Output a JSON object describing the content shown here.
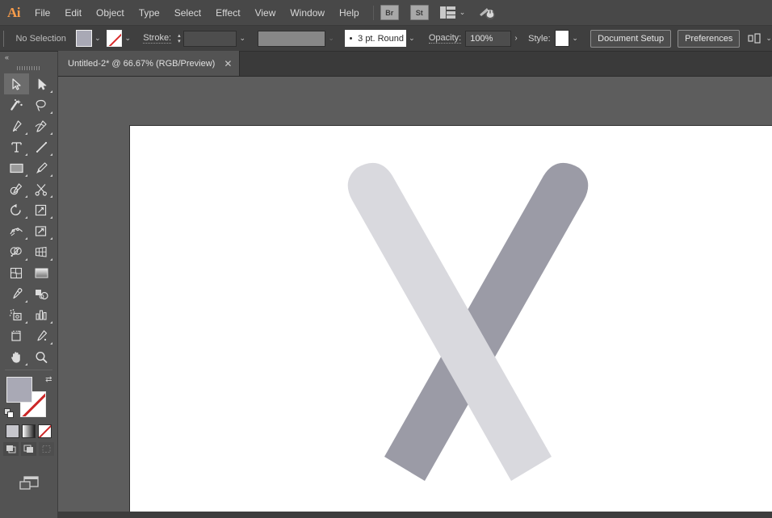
{
  "app": {
    "name": "Adobe Illustrator",
    "logo_text": "Ai"
  },
  "menubar": {
    "items": [
      {
        "label": "File"
      },
      {
        "label": "Edit"
      },
      {
        "label": "Object"
      },
      {
        "label": "Type"
      },
      {
        "label": "Select"
      },
      {
        "label": "Effect"
      },
      {
        "label": "View"
      },
      {
        "label": "Window"
      },
      {
        "label": "Help"
      }
    ],
    "bridge_label": "Br",
    "stock_label": "St",
    "arrange_icon": "arrange-documents-icon",
    "arrange_chevron": "⌄",
    "workspace_icon": "workspace-switcher-icon"
  },
  "controlbar": {
    "selection_status": "No Selection",
    "fill_swatch_label": "fill-color",
    "fill_color": "#a9a9b5",
    "fill_chevron": "⌄",
    "stroke_swatch_label": "stroke-none",
    "stroke_color": "none",
    "stroke_chevron": "⌄",
    "stroke_label": "Stroke:",
    "stroke_weight_value": "",
    "stepper_up": "▴",
    "stepper_down": "▾",
    "stroke_field_chevron": "⌄",
    "variable_width_chevron": "⌄",
    "brush_definition": "3 pt. Round",
    "brush_chevron": "⌄",
    "opacity_label": "Opacity:",
    "opacity_value": "100%",
    "opacity_more": "›",
    "style_label": "Style:",
    "style_chevron": "⌄",
    "document_setup_label": "Document Setup",
    "preferences_label": "Preferences",
    "align_icon": "align-objects-icon",
    "align_chevron": "⌄"
  },
  "tabbar": {
    "document_title": "Untitled-2* @ 66.67% (RGB/Preview)",
    "close_glyph": "✕"
  },
  "toolbar": {
    "collapse_glyph": "«",
    "tools": [
      {
        "name": "selection-tool",
        "active": true,
        "flyout": false
      },
      {
        "name": "direct-selection-tool",
        "active": false,
        "flyout": true
      },
      {
        "name": "magic-wand-tool",
        "active": false,
        "flyout": false
      },
      {
        "name": "lasso-tool",
        "active": false,
        "flyout": false
      },
      {
        "name": "pen-tool",
        "active": false,
        "flyout": true
      },
      {
        "name": "curvature-tool",
        "active": false,
        "flyout": false
      },
      {
        "name": "type-tool",
        "active": false,
        "flyout": true
      },
      {
        "name": "line-segment-tool",
        "active": false,
        "flyout": true
      },
      {
        "name": "rectangle-tool",
        "active": false,
        "flyout": true
      },
      {
        "name": "paintbrush-tool",
        "active": false,
        "flyout": true
      },
      {
        "name": "shaper-pencil-tool",
        "active": false,
        "flyout": true
      },
      {
        "name": "scissors-eraser-tool",
        "active": false,
        "flyout": true
      },
      {
        "name": "rotate-tool",
        "active": false,
        "flyout": true
      },
      {
        "name": "scale-tool",
        "active": false,
        "flyout": true
      },
      {
        "name": "width-warp-tool",
        "active": false,
        "flyout": true
      },
      {
        "name": "free-transform-tool",
        "active": false,
        "flyout": true
      },
      {
        "name": "shape-builder-tool",
        "active": false,
        "flyout": true
      },
      {
        "name": "perspective-grid-tool",
        "active": false,
        "flyout": true
      },
      {
        "name": "mesh-tool",
        "active": false,
        "flyout": false
      },
      {
        "name": "gradient-tool",
        "active": false,
        "flyout": false
      },
      {
        "name": "eyedropper-tool",
        "active": false,
        "flyout": true
      },
      {
        "name": "blend-tool",
        "active": false,
        "flyout": false
      },
      {
        "name": "symbol-sprayer-tool",
        "active": false,
        "flyout": true
      },
      {
        "name": "column-graph-tool",
        "active": false,
        "flyout": true
      },
      {
        "name": "artboard-tool",
        "active": false,
        "flyout": false
      },
      {
        "name": "slice-tool",
        "active": false,
        "flyout": true
      },
      {
        "name": "hand-tool",
        "active": false,
        "flyout": true
      },
      {
        "name": "zoom-tool",
        "active": false,
        "flyout": false
      }
    ],
    "fill_color": "#a9a9b5",
    "stroke_color": "none",
    "swap_glyph": "⇄",
    "color_modes": [
      {
        "name": "color-button",
        "label": "color"
      },
      {
        "name": "gradient-button",
        "label": "gradient"
      },
      {
        "name": "none-button",
        "label": "none"
      }
    ],
    "draw_modes": [
      {
        "name": "draw-normal-button",
        "active": true
      },
      {
        "name": "draw-behind-button",
        "active": false
      },
      {
        "name": "draw-inside-button",
        "active": false
      }
    ],
    "screen_mode": "change-screen-mode-button"
  },
  "canvas": {
    "background_color": "#5d5d5d",
    "artboard_color": "#ffffff",
    "artwork": {
      "name": "crossed-strokes-x-artwork",
      "light_stroke_color": "#d9d9de",
      "dark_stroke_color": "#9b9ba6"
    }
  }
}
